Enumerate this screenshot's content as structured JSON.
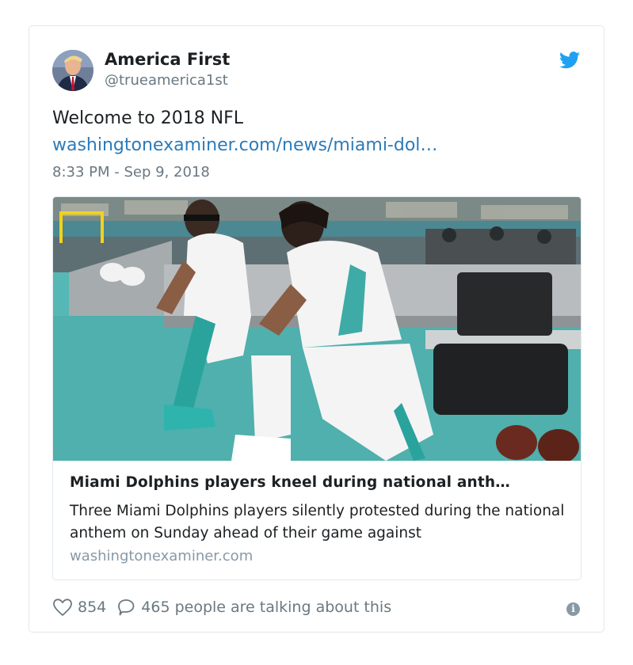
{
  "tweet": {
    "display_name": "America First",
    "screen_name": "@trueamerica1st",
    "text": "Welcome to 2018 NFL",
    "link_text": "washingtonexaminer.com/news/miami-dol…",
    "timestamp": "8:33 PM - Sep 9, 2018"
  },
  "card": {
    "title": "Miami Dolphins players kneel during national anth…",
    "description": "Three Miami Dolphins players silently protested during the national anthem on Sunday ahead of their game against",
    "domain": "washingtonexaminer.com"
  },
  "footer": {
    "likes": "854",
    "talking": "465 people are talking about this"
  },
  "icons": {
    "brand": "twitter-bird-icon",
    "like": "heart-icon",
    "reply": "speech-bubble-icon",
    "info": "info-icon"
  },
  "colors": {
    "link": "#2b7bb9",
    "twitter_blue": "#1da1f2",
    "muted": "#697882"
  }
}
